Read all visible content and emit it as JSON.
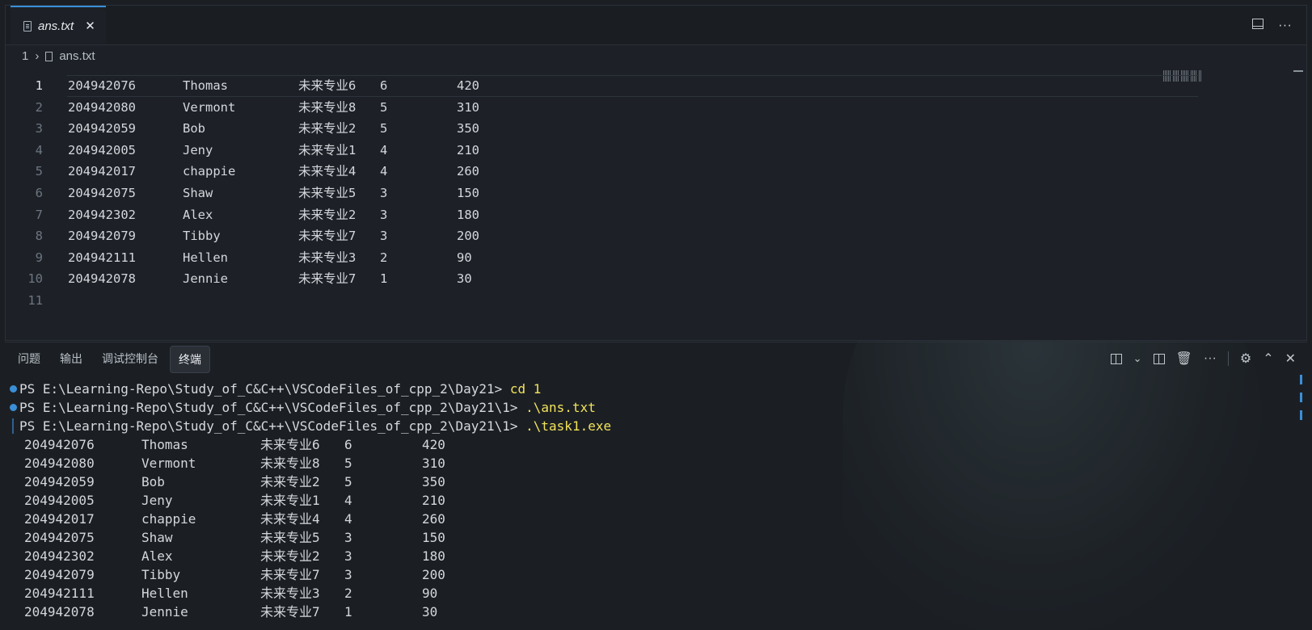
{
  "editor": {
    "tab_title": "ans.txt",
    "tab_close": "✕",
    "more": "···",
    "breadcrumb": {
      "folder": "1",
      "file": "ans.txt"
    },
    "lines": [
      {
        "n": "1",
        "id": "204942076",
        "name": "Thomas",
        "major": "未来专业6",
        "a": "6",
        "b": "420"
      },
      {
        "n": "2",
        "id": "204942080",
        "name": "Vermont",
        "major": "未来专业8",
        "a": "5",
        "b": "310"
      },
      {
        "n": "3",
        "id": "204942059",
        "name": "Bob",
        "major": "未来专业2",
        "a": "5",
        "b": "350"
      },
      {
        "n": "4",
        "id": "204942005",
        "name": "Jeny",
        "major": "未来专业1",
        "a": "4",
        "b": "210"
      },
      {
        "n": "5",
        "id": "204942017",
        "name": "chappie",
        "major": "未来专业4",
        "a": "4",
        "b": "260"
      },
      {
        "n": "6",
        "id": "204942075",
        "name": "Shaw",
        "major": "未来专业5",
        "a": "3",
        "b": "150"
      },
      {
        "n": "7",
        "id": "204942302",
        "name": "Alex",
        "major": "未来专业2",
        "a": "3",
        "b": "180"
      },
      {
        "n": "8",
        "id": "204942079",
        "name": "Tibby",
        "major": "未来专业7",
        "a": "3",
        "b": "200"
      },
      {
        "n": "9",
        "id": "204942111",
        "name": "Hellen",
        "major": "未来专业3",
        "a": "2",
        "b": "90"
      },
      {
        "n": "10",
        "id": "204942078",
        "name": "Jennie",
        "major": "未来专业7",
        "a": "1",
        "b": "30"
      },
      {
        "n": "11",
        "id": "",
        "name": "",
        "major": "",
        "a": "",
        "b": ""
      }
    ]
  },
  "panel": {
    "tabs": [
      "问题",
      "输出",
      "调试控制台",
      "终端"
    ],
    "active_tab": 3
  },
  "terminal": {
    "prompts": [
      {
        "text": "PS E:\\Learning-Repo\\Study_of_C&C++\\VSCodeFiles_of_cpp_2\\Day21> ",
        "cmd": "cd 1"
      },
      {
        "text": "PS E:\\Learning-Repo\\Study_of_C&C++\\VSCodeFiles_of_cpp_2\\Day21\\1> ",
        "cmd": ".\\ans.txt"
      },
      {
        "text": "PS E:\\Learning-Repo\\Study_of_C&C++\\VSCodeFiles_of_cpp_2\\Day21\\1> ",
        "cmd": ".\\task1.exe"
      }
    ],
    "rows": [
      {
        "id": "204942076",
        "name": "Thomas",
        "major": "未来专业6",
        "a": "6",
        "b": "420"
      },
      {
        "id": "204942080",
        "name": "Vermont",
        "major": "未来专业8",
        "a": "5",
        "b": "310"
      },
      {
        "id": "204942059",
        "name": "Bob",
        "major": "未来专业2",
        "a": "5",
        "b": "350"
      },
      {
        "id": "204942005",
        "name": "Jeny",
        "major": "未来专业1",
        "a": "4",
        "b": "210"
      },
      {
        "id": "204942017",
        "name": "chappie",
        "major": "未来专业4",
        "a": "4",
        "b": "260"
      },
      {
        "id": "204942075",
        "name": "Shaw",
        "major": "未来专业5",
        "a": "3",
        "b": "150"
      },
      {
        "id": "204942302",
        "name": "Alex",
        "major": "未来专业2",
        "a": "3",
        "b": "180"
      },
      {
        "id": "204942079",
        "name": "Tibby",
        "major": "未来专业7",
        "a": "3",
        "b": "200"
      },
      {
        "id": "204942111",
        "name": "Hellen",
        "major": "未来专业3",
        "a": "2",
        "b": "90"
      },
      {
        "id": "204942078",
        "name": "Jennie",
        "major": "未来专业7",
        "a": "1",
        "b": "30"
      }
    ]
  }
}
